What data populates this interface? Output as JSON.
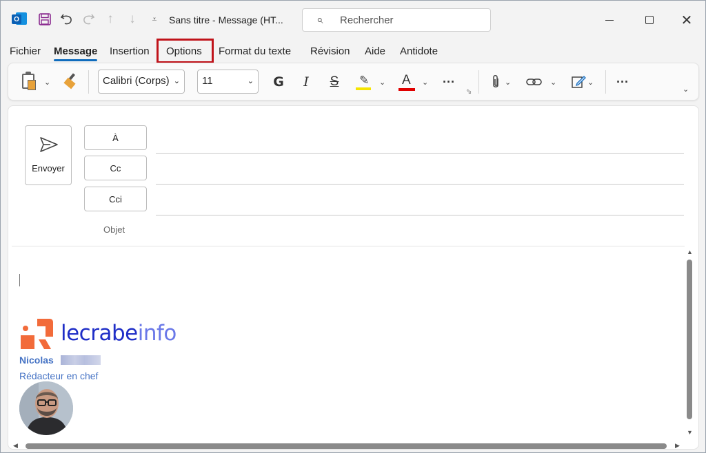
{
  "titlebar": {
    "window_title": "Sans titre  -  Message (HT...",
    "search_placeholder": "Rechercher",
    "icons": [
      "outlook-icon",
      "save-icon",
      "undo-icon",
      "redo-icon",
      "up-arrow-icon",
      "down-arrow-icon",
      "customize-quick-access-icon"
    ]
  },
  "menu": {
    "tabs": [
      {
        "label": "Fichier",
        "active": false
      },
      {
        "label": "Message",
        "active": true
      },
      {
        "label": "Insertion",
        "active": false
      },
      {
        "label": "Options",
        "active": false,
        "highlighted": true
      },
      {
        "label": "Format du texte",
        "active": false
      },
      {
        "label": "Révision",
        "active": false
      },
      {
        "label": "Aide",
        "active": false
      },
      {
        "label": "Antidote",
        "active": false
      }
    ],
    "highlight_color": "#c0131a",
    "active_underline_color": "#0f6cbd"
  },
  "ribbon": {
    "font_name": "Calibri (Corps)",
    "font_size": "11",
    "bold_glyph": "G",
    "italic_glyph": "I",
    "strike_glyph": "S",
    "font_color_glyph": "A",
    "more_glyph": "···",
    "highlight_color": "#f5e400",
    "font_color": "#e00000"
  },
  "compose": {
    "send_label": "Envoyer",
    "to_label": "À",
    "cc_label": "Cc",
    "bcc_label": "Cci",
    "subject_label": "Objet"
  },
  "signature": {
    "logo_text_main": "lecrabe",
    "logo_text_accent": "info",
    "name": "Nicolas",
    "role": "Rédacteur en chef",
    "logo_color": "#f26b3a",
    "text_color": "#4472c4"
  }
}
